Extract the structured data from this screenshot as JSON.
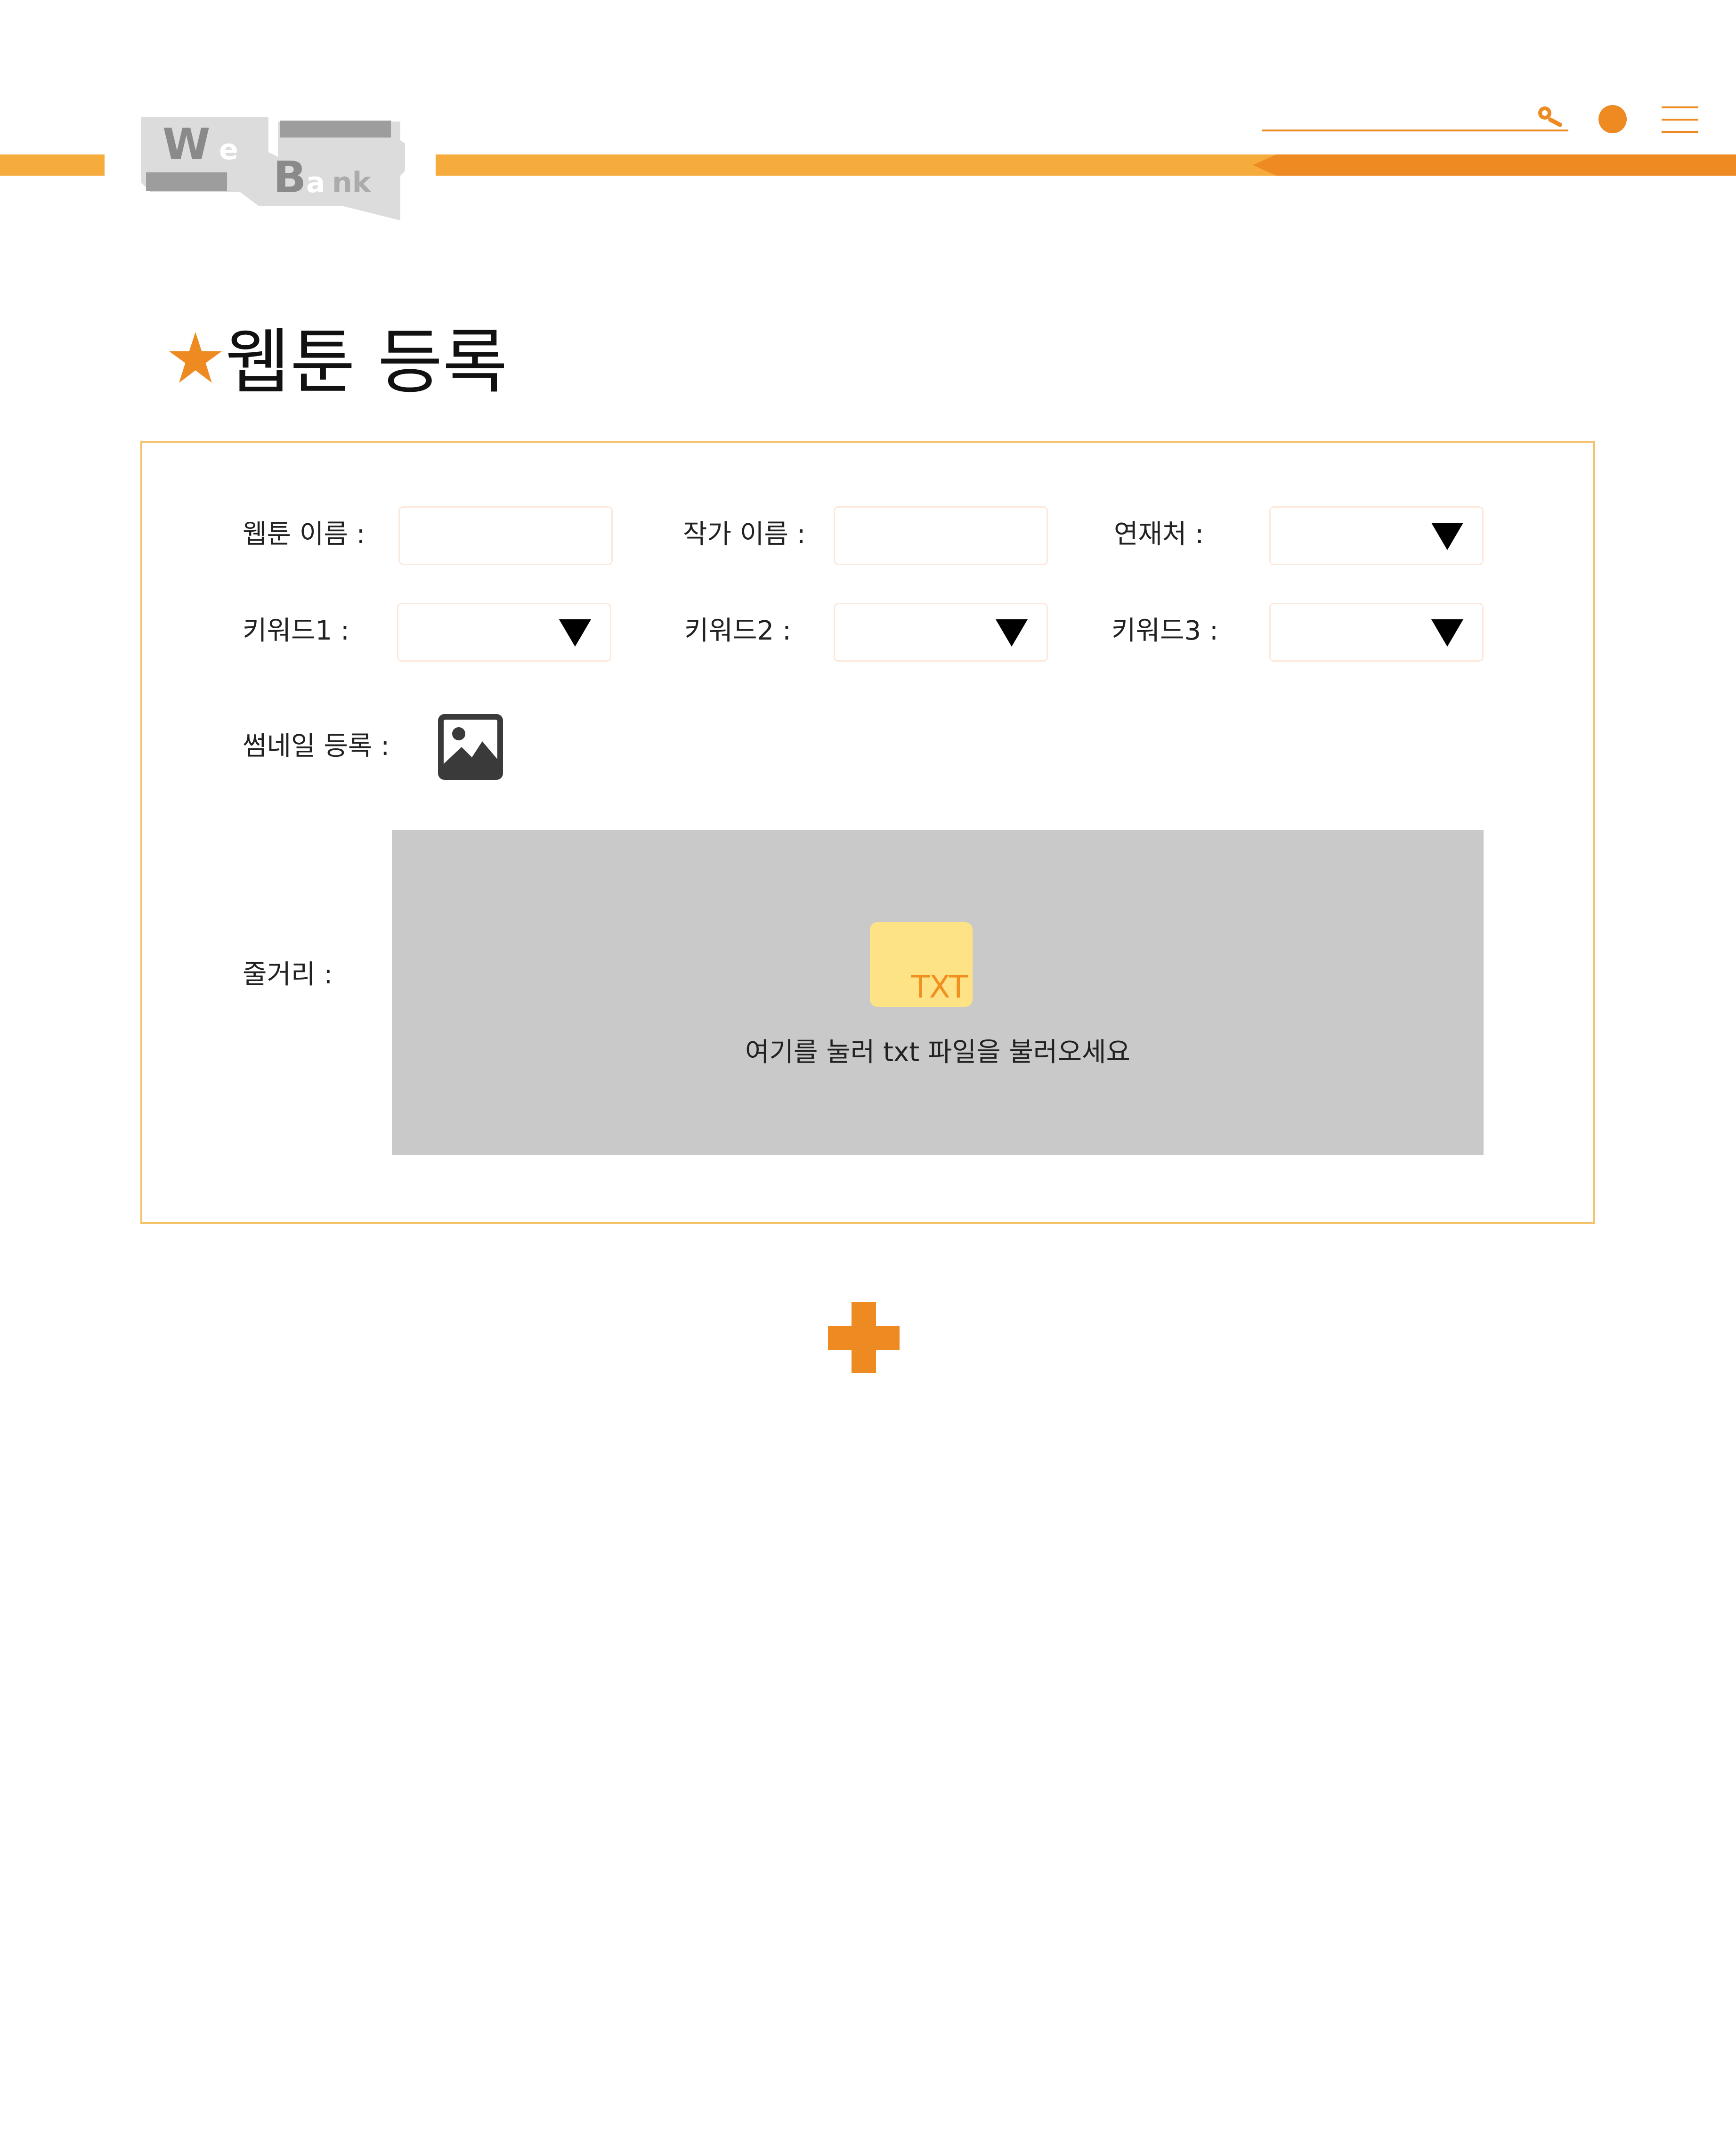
{
  "header": {
    "logo_alt": "WeBank",
    "search_icon": "search-icon",
    "profile_icon": "profile-dot-icon",
    "menu_icon": "hamburger-menu-icon"
  },
  "page": {
    "title": "웹툰 등록",
    "title_icon": "star-icon"
  },
  "form": {
    "webtoon_name_label": "웹툰 이름 :",
    "webtoon_name_value": "",
    "author_name_label": "작가 이름 :",
    "author_name_value": "",
    "platform_label": "연재처 :",
    "platform_value": "",
    "keyword1_label": "키워드1 :",
    "keyword1_value": "",
    "keyword2_label": "키워드2 :",
    "keyword2_value": "",
    "keyword3_label": "키워드3 :",
    "keyword3_value": "",
    "thumbnail_label": "썸네일 등록 :",
    "thumbnail_icon": "image-icon",
    "synopsis_label": "줄거리 :",
    "upload_badge": "TXT",
    "upload_hint": "여기를 눌러 txt 파일을 불러오세요"
  },
  "actions": {
    "add_icon": "plus-icon"
  },
  "colors": {
    "accent_light": "#f5ac3c",
    "accent_dark": "#ee8a22",
    "upload_bg": "#c8c9c8",
    "txt_badge_bg": "#fde286"
  }
}
